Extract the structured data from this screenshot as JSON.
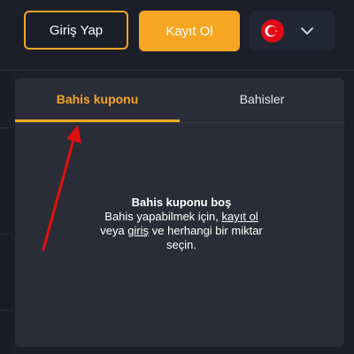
{
  "header": {
    "login_label": "Giriş Yap",
    "register_label": "Kayıt Ol",
    "language_flag": "turkey-flag-icon"
  },
  "bet_panel": {
    "tabs": [
      {
        "label": "Bahis kuponu",
        "active": true
      },
      {
        "label": "Bahisler",
        "active": false
      }
    ],
    "empty_state": {
      "title": "Bahis kuponu boş",
      "text_before_link": "Bahis yapabilmek için, ",
      "register_link": "kayıt ol",
      "text_middle": " veya ",
      "login_link": "giriş",
      "text_after": " ve herhangi bir miktar seçin."
    }
  },
  "colors": {
    "accent": "#f6a623",
    "background": "#1c1f2a",
    "panel": "#2a2d37",
    "annotation_arrow": "#e01010"
  }
}
